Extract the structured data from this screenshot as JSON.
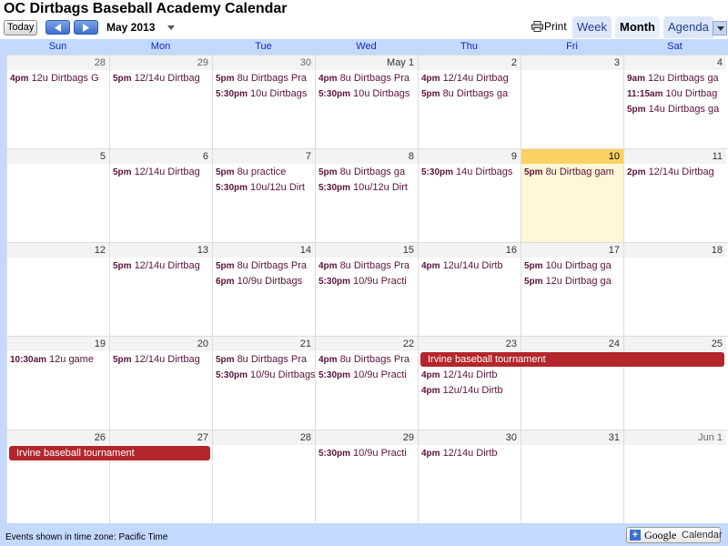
{
  "header": {
    "title": "OC Dirtbags Baseball Academy Calendar",
    "today_label": "Today",
    "month_label": "May 2013",
    "print_label": "Print",
    "tabs": [
      "Week",
      "Month",
      "Agenda"
    ]
  },
  "days_of_week": [
    "Sun",
    "Mon",
    "Tue",
    "Wed",
    "Thu",
    "Fri",
    "Sat"
  ],
  "weeks": [
    {
      "days": [
        {
          "num": "28",
          "events": [
            {
              "time": "4pm",
              "text": "12u Dirtbags G"
            }
          ]
        },
        {
          "num": "29",
          "events": [
            {
              "time": "5pm",
              "text": "12/14u Dirtbag"
            }
          ]
        },
        {
          "num": "30",
          "events": [
            {
              "time": "5pm",
              "text": "8u Dirtbags Pra"
            },
            {
              "time": "5:30pm",
              "text": "10u Dirtbags"
            }
          ]
        },
        {
          "num": "May 1",
          "events": [
            {
              "time": "4pm",
              "text": "8u Dirtbags Pra"
            },
            {
              "time": "5:30pm",
              "text": "10u Dirtbags"
            }
          ]
        },
        {
          "num": "2",
          "events": [
            {
              "time": "4pm",
              "text": "12/14u Dirtbag"
            },
            {
              "time": "5pm",
              "text": "8u Dirtbags ga"
            }
          ]
        },
        {
          "num": "3",
          "events": []
        },
        {
          "num": "4",
          "events": [
            {
              "time": "9am",
              "text": "12u Dirtbags ga"
            },
            {
              "time": "11:15am",
              "text": "10u Dirtbag"
            },
            {
              "time": "5pm",
              "text": "14u Dirtbags ga"
            }
          ]
        }
      ]
    },
    {
      "days": [
        {
          "num": "5",
          "events": []
        },
        {
          "num": "6",
          "events": [
            {
              "time": "5pm",
              "text": "12/14u Dirtbag"
            }
          ]
        },
        {
          "num": "7",
          "events": [
            {
              "time": "5pm",
              "text": "8u practice"
            },
            {
              "time": "5:30pm",
              "text": "10u/12u Dirt"
            }
          ]
        },
        {
          "num": "8",
          "events": [
            {
              "time": "5pm",
              "text": "8u Dirtbags ga"
            },
            {
              "time": "5:30pm",
              "text": "10u/12u Dirt"
            }
          ]
        },
        {
          "num": "9",
          "events": [
            {
              "time": "5:30pm",
              "text": "14u Dirtbags"
            }
          ]
        },
        {
          "num": "10",
          "events": [
            {
              "time": "5pm",
              "text": "8u Dirtbag gam"
            }
          ]
        },
        {
          "num": "11",
          "events": [
            {
              "time": "2pm",
              "text": "12/14u Dirtbag"
            }
          ]
        }
      ]
    },
    {
      "days": [
        {
          "num": "12",
          "events": []
        },
        {
          "num": "13",
          "events": [
            {
              "time": "5pm",
              "text": "12/14u Dirtbag"
            }
          ]
        },
        {
          "num": "14",
          "events": [
            {
              "time": "5pm",
              "text": "8u Dirtbags Pra"
            },
            {
              "time": "6pm",
              "text": "10/9u Dirtbags"
            }
          ]
        },
        {
          "num": "15",
          "events": [
            {
              "time": "4pm",
              "text": "8u Dirtbags Pra"
            },
            {
              "time": "5:30pm",
              "text": "10/9u Practi"
            }
          ]
        },
        {
          "num": "16",
          "events": [
            {
              "time": "4pm",
              "text": "12u/14u Dirtb"
            }
          ]
        },
        {
          "num": "17",
          "events": [
            {
              "time": "5pm",
              "text": "10u Dirtbag ga"
            },
            {
              "time": "5pm",
              "text": "12u Dirtbag ga"
            }
          ]
        },
        {
          "num": "18",
          "events": []
        }
      ]
    },
    {
      "days": [
        {
          "num": "19",
          "events": [
            {
              "time": "10:30am",
              "text": "12u game"
            }
          ]
        },
        {
          "num": "20",
          "events": [
            {
              "time": "5pm",
              "text": "12/14u Dirtbag"
            }
          ]
        },
        {
          "num": "21",
          "events": [
            {
              "time": "5pm",
              "text": "8u Dirtbags Pra"
            },
            {
              "time": "5:30pm",
              "text": "10/9u Dirtbags"
            }
          ]
        },
        {
          "num": "22",
          "events": [
            {
              "time": "4pm",
              "text": "8u Dirtbags Pra"
            },
            {
              "time": "5:30pm",
              "text": "10/9u Practi"
            }
          ]
        },
        {
          "num": "23",
          "events": [
            {
              "time": "",
              "text": ""
            },
            {
              "time": "4pm",
              "text": "12/14u Dirtb"
            },
            {
              "time": "4pm",
              "text": "12u/14u Dirtb"
            }
          ]
        },
        {
          "num": "24",
          "events": []
        },
        {
          "num": "25",
          "events": []
        }
      ],
      "allday": {
        "text": "Irvine baseball tournament"
      }
    },
    {
      "days": [
        {
          "num": "26",
          "events": []
        },
        {
          "num": "27",
          "events": []
        },
        {
          "num": "28",
          "events": []
        },
        {
          "num": "29",
          "events": [
            {
              "time": "5:30pm",
              "text": "10/9u Practi"
            }
          ]
        },
        {
          "num": "30",
          "events": [
            {
              "time": "4pm",
              "text": "12/14u Dirtb"
            }
          ]
        },
        {
          "num": "31",
          "events": []
        },
        {
          "num": "Jun 1",
          "events": []
        }
      ],
      "allday": {
        "text": "Irvine baseball tournament"
      }
    }
  ],
  "footer": {
    "timezone_text": "Events shown in time zone: Pacific Time",
    "gcal_google": "Google",
    "gcal_calendar": "Calendar"
  }
}
